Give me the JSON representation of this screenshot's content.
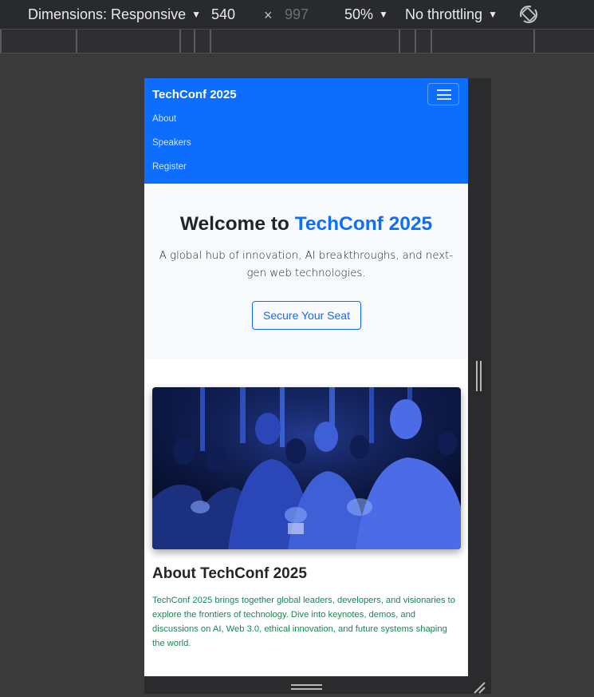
{
  "devtools": {
    "dimensions_label": "Dimensions: Responsive",
    "width_value": "540",
    "times_symbol": "×",
    "height_value": "997",
    "zoom": "50%",
    "throttling": "No throttling",
    "rotate_icon": "rotate-icon"
  },
  "navbar": {
    "brand": "TechConf 2025",
    "links": [
      "About",
      "Speakers",
      "Register"
    ],
    "toggler_icon": "hamburger-icon",
    "bg_color": "#0d6efd"
  },
  "hero": {
    "title_prefix": "Welcome to ",
    "title_accent": "TechConf 2025",
    "subtitle": "A global hub of innovation, AI breakthroughs, and next-gen web technologies.",
    "cta_label": "Secure Your Seat",
    "accent_color": "#0d6efd"
  },
  "about": {
    "image_alt": "conference-audience-photo",
    "title": "About TechConf 2025",
    "text": "TechConf 2025 brings together global leaders, developers, and visionaries to explore the frontiers of technology. Dive into keynotes, demos, and discussions on AI, Web 3.0, ethical innovation, and future systems shaping the world.",
    "text_color": "#198754"
  }
}
